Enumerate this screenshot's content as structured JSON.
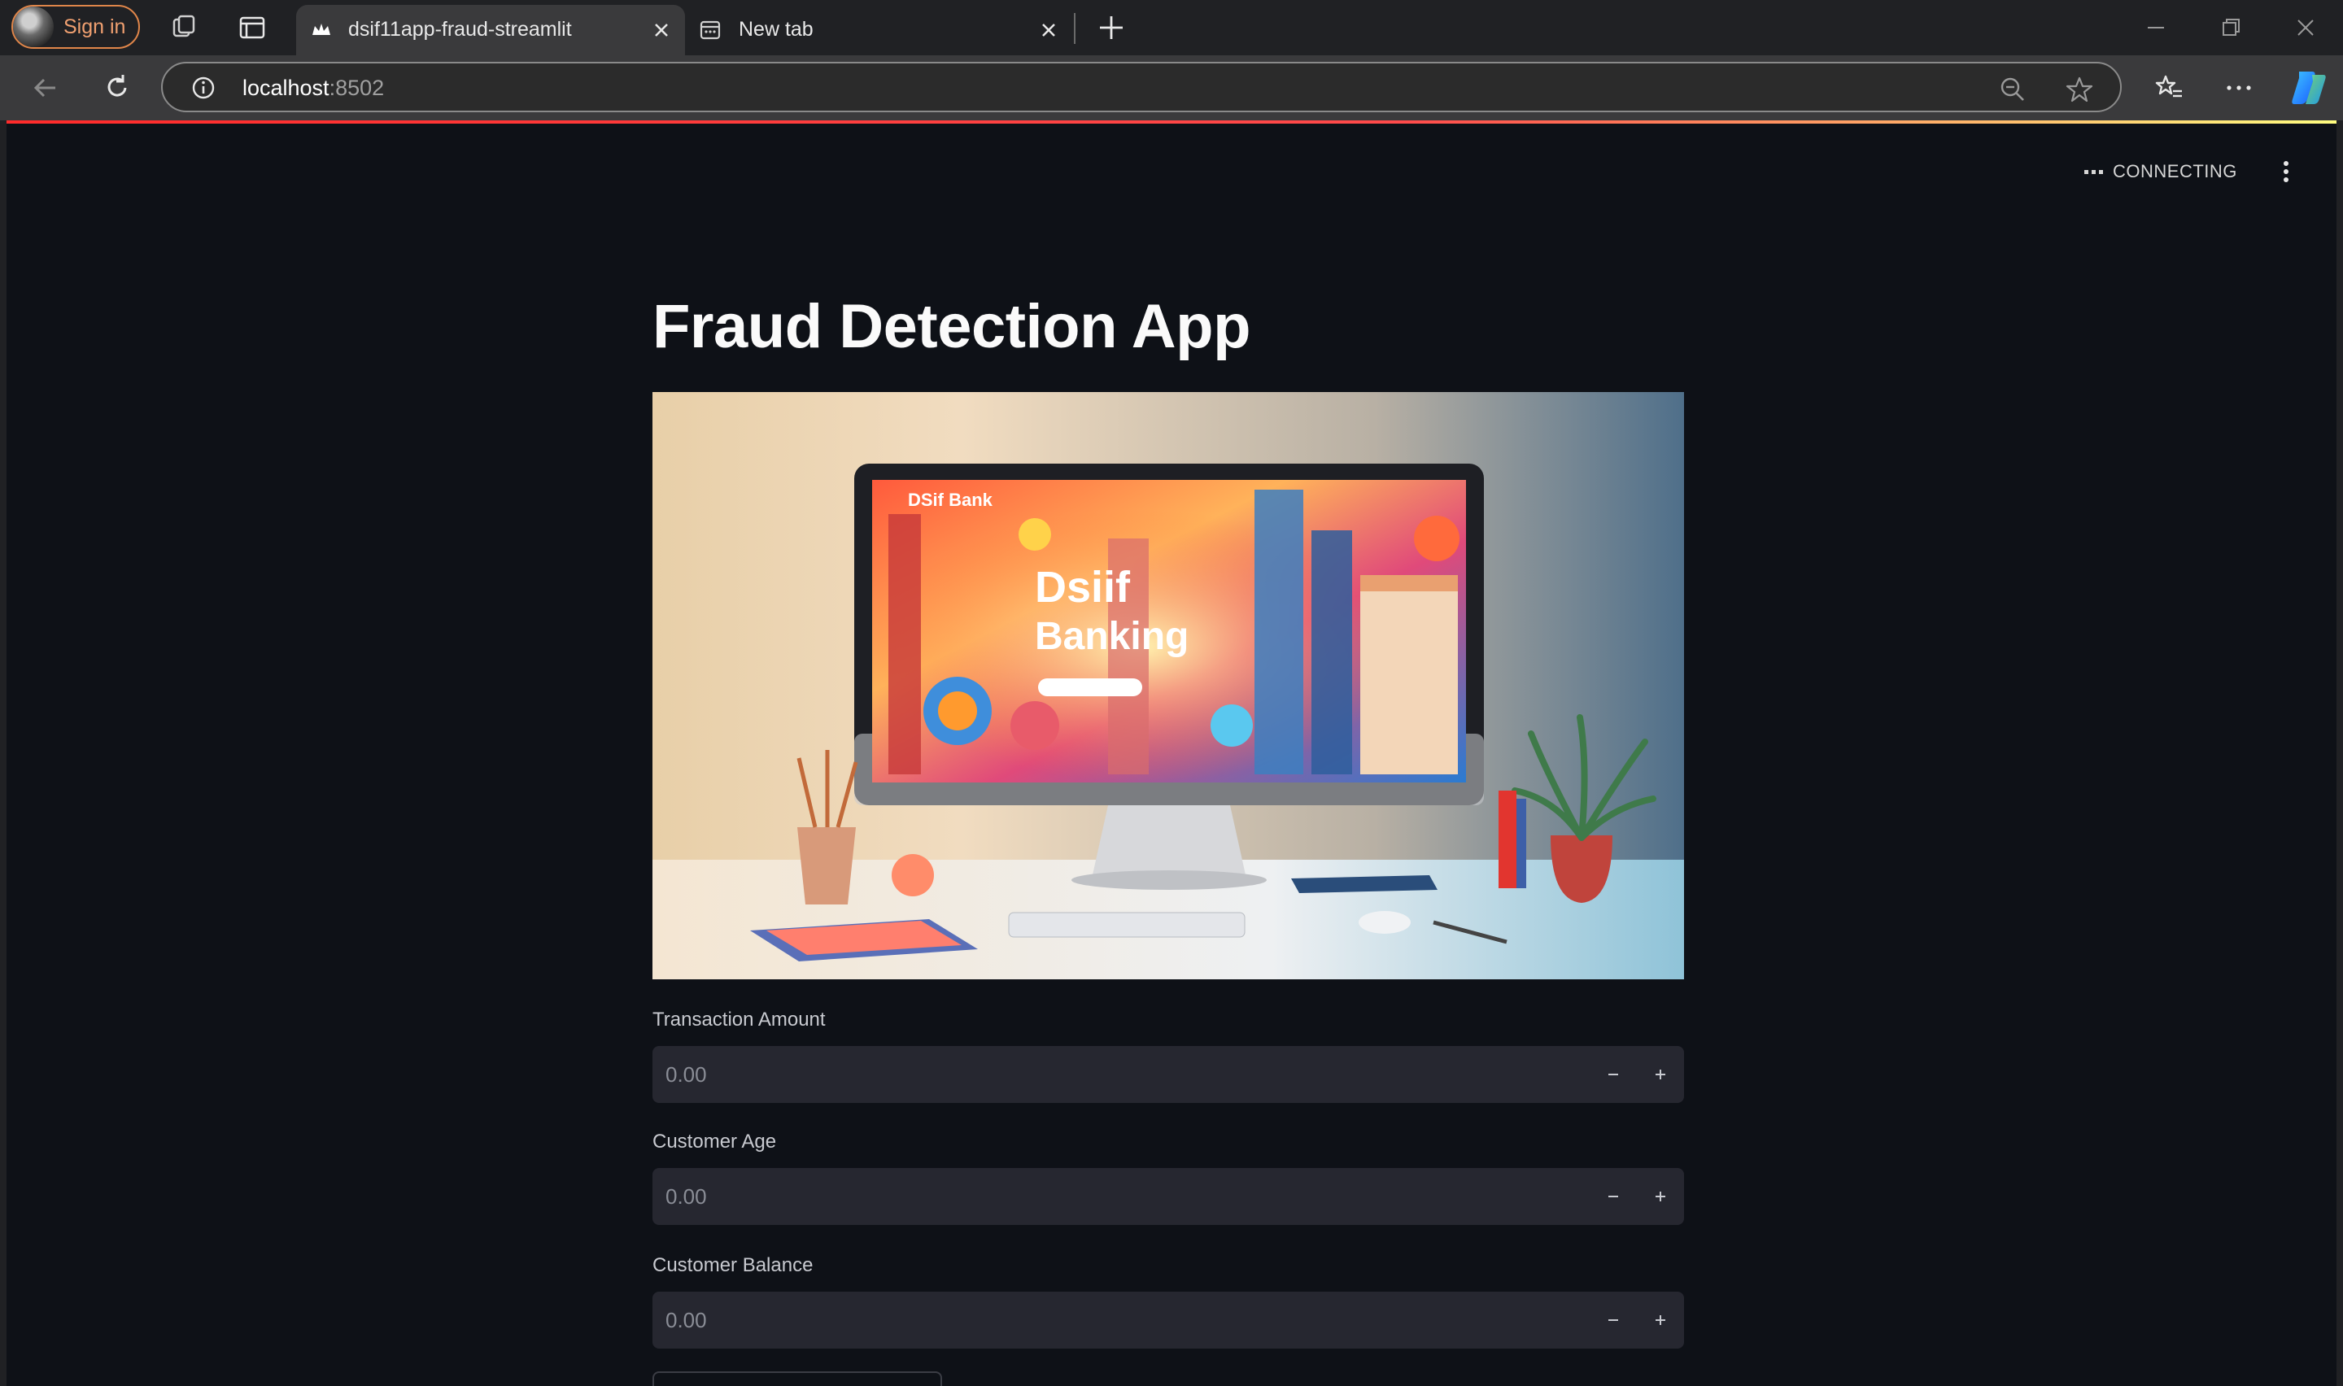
{
  "browser": {
    "signin_label": "Sign in",
    "tabs": [
      {
        "title": "dsif11app-fraud-streamlit",
        "active": true
      },
      {
        "title": "New tab",
        "active": false
      }
    ],
    "address": {
      "host": "localhost",
      "port": ":8502"
    }
  },
  "app": {
    "status": "CONNECTING",
    "title": "Fraud Detection App",
    "hero_image": {
      "brand_text": "DSif Bank",
      "headline_line1": "Dsiif",
      "headline_line2": "Banking"
    },
    "fields": [
      {
        "label": "Transaction Amount",
        "value": "0.00"
      },
      {
        "label": "Customer Age",
        "value": "0.00"
      },
      {
        "label": "Customer Balance",
        "value": "0.00"
      }
    ]
  },
  "colors": {
    "page_background": "#0e1117",
    "input_background": "#262730",
    "browser_chrome": "#202124",
    "accent": "#ff4b4b",
    "signin_border": "#e0864a"
  }
}
